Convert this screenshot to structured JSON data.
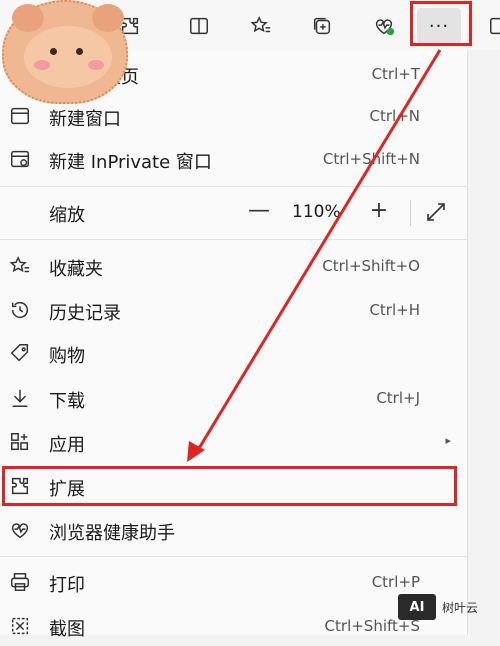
{
  "menu": {
    "new_tab": {
      "label": "新建标签页",
      "shortcut": "Ctrl+T"
    },
    "new_window": {
      "label": "新建窗口",
      "shortcut": "Ctrl+N"
    },
    "new_inprivate": {
      "label": "新建 InPrivate 窗口",
      "shortcut": "Ctrl+Shift+N"
    },
    "zoom": {
      "label": "缩放",
      "minus": "—",
      "value": "110%",
      "plus": "+"
    },
    "favorites": {
      "label": "收藏夹",
      "shortcut": "Ctrl+Shift+O"
    },
    "history": {
      "label": "历史记录",
      "shortcut": "Ctrl+H"
    },
    "shopping": {
      "label": "购物"
    },
    "downloads": {
      "label": "下载",
      "shortcut": "Ctrl+J"
    },
    "apps": {
      "label": "应用",
      "arrow": "▸"
    },
    "extensions": {
      "label": "扩展"
    },
    "health": {
      "label": "浏览器健康助手"
    },
    "print": {
      "label": "打印",
      "shortcut": "Ctrl+P"
    },
    "screenshot": {
      "label": "截图",
      "shortcut": "Ctrl+Shift+S"
    }
  },
  "toolbar": {
    "more_label": "···",
    "icons": [
      "extensions-icon",
      "split-screen-icon",
      "favorites-icon",
      "collections-icon",
      "browser-health-icon",
      "more-icon",
      "sidebar-icon"
    ]
  },
  "watermark": {
    "logo": "AI",
    "text": "树叶云"
  },
  "colors": {
    "highlight": "#e02424",
    "arrow": "#e02424",
    "health_badge": "#2ea043"
  }
}
